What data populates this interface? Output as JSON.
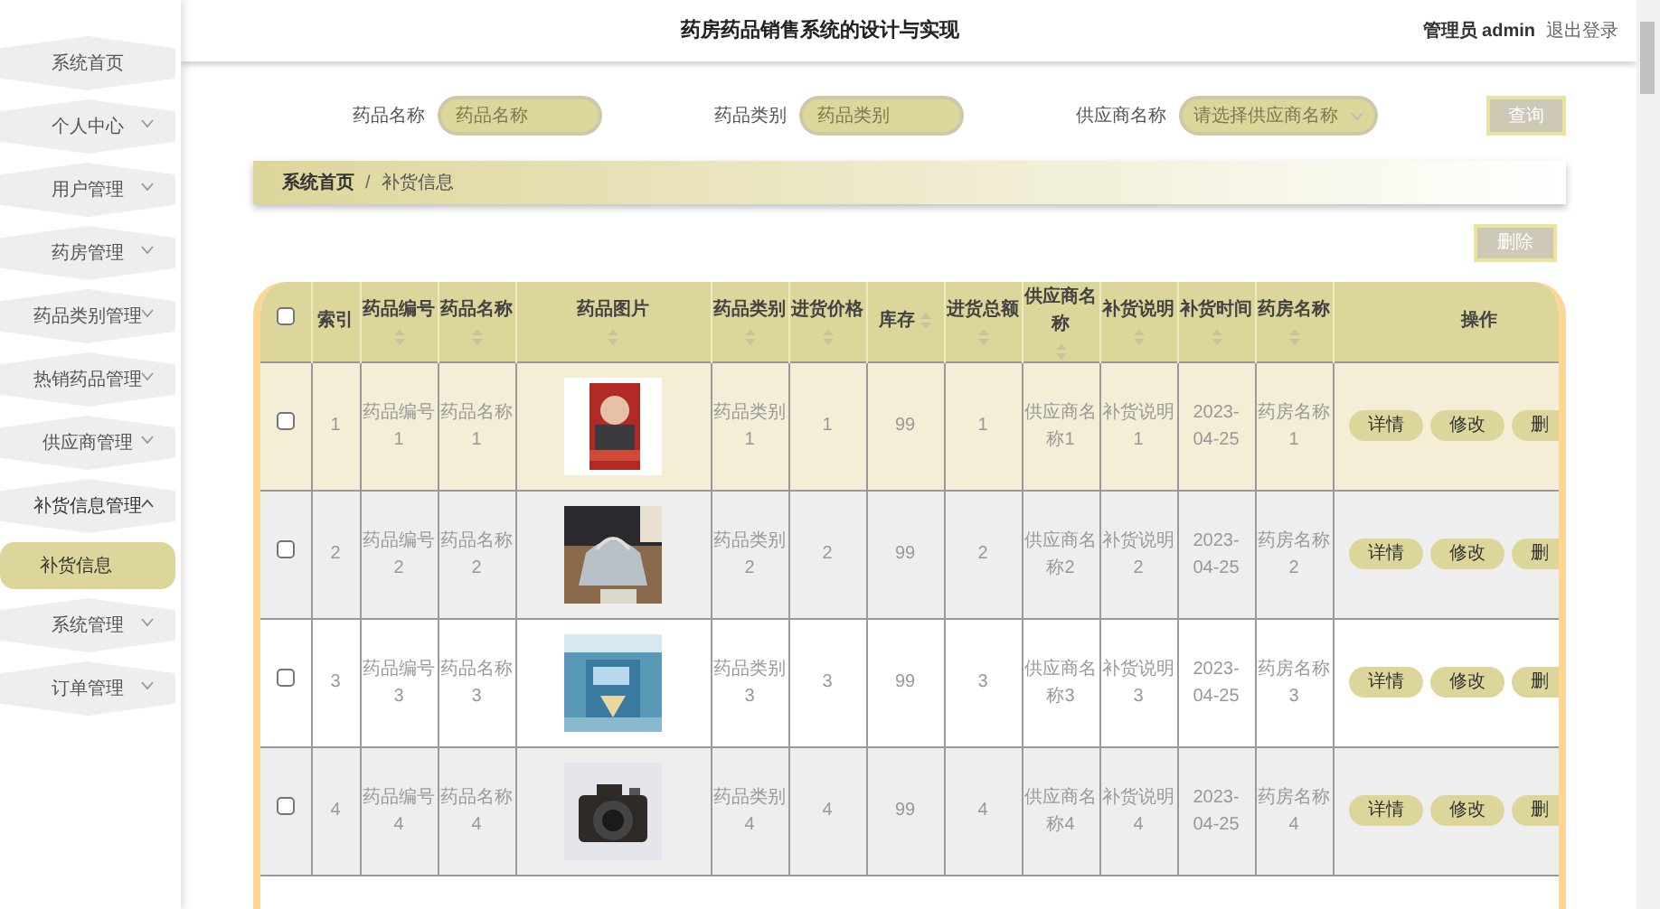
{
  "header": {
    "title": "药房药品销售系统的设计与实现",
    "user_role": "管理员",
    "user_name": "admin",
    "logout": "退出登录"
  },
  "sidebar": {
    "items": [
      {
        "label": "系统首页",
        "kind": "link"
      },
      {
        "label": "个人中心",
        "kind": "menu",
        "expanded": false
      },
      {
        "label": "用户管理",
        "kind": "menu",
        "expanded": false
      },
      {
        "label": "药房管理",
        "kind": "menu",
        "expanded": false
      },
      {
        "label": "药品类别管理",
        "kind": "menu",
        "expanded": false
      },
      {
        "label": "热销药品管理",
        "kind": "menu",
        "expanded": false
      },
      {
        "label": "供应商管理",
        "kind": "menu",
        "expanded": false
      },
      {
        "label": "补货信息管理",
        "kind": "menu",
        "expanded": true,
        "children": [
          {
            "label": "补货信息",
            "selected": true
          }
        ]
      },
      {
        "label": "系统管理",
        "kind": "menu",
        "expanded": false
      },
      {
        "label": "订单管理",
        "kind": "menu",
        "expanded": false
      }
    ]
  },
  "search": {
    "fields": [
      {
        "label": "药品名称",
        "placeholder": "药品名称",
        "kind": "input"
      },
      {
        "label": "药品类别",
        "placeholder": "药品类别",
        "kind": "input"
      },
      {
        "label": "供应商名称",
        "placeholder": "请选择供应商名称",
        "kind": "select"
      }
    ],
    "button": "查询"
  },
  "breadcrumb": {
    "items": [
      "系统首页",
      "补货信息"
    ],
    "separator": "/"
  },
  "delete_button": "删除",
  "table": {
    "select_all_checked": false,
    "columns": [
      {
        "label": "索引",
        "kind": "text",
        "sortable": false
      },
      {
        "label": "药品编号",
        "kind": "text",
        "sortable": true
      },
      {
        "label": "药品名称",
        "kind": "text",
        "sortable": true
      },
      {
        "label": "药品图片",
        "kind": "picture",
        "sortable": true
      },
      {
        "label": "药品类别",
        "kind": "text",
        "sortable": true
      },
      {
        "label": "进货价格",
        "kind": "text",
        "sortable": true
      },
      {
        "label": "库存",
        "kind": "text",
        "sortable": true
      },
      {
        "label": "进货总额",
        "kind": "text",
        "sortable": true
      },
      {
        "label": "供应商名称",
        "kind": "text",
        "sortable": true
      },
      {
        "label": "补货说明",
        "kind": "text",
        "sortable": true
      },
      {
        "label": "补货时间",
        "kind": "text",
        "sortable": true
      },
      {
        "label": "药房名称",
        "kind": "text",
        "sortable": true
      },
      {
        "label": "操作",
        "kind": "actions",
        "sortable": false
      }
    ],
    "rows": [
      {
        "checked": false,
        "hovered": true,
        "cells": [
          "1",
          "药品编号1",
          "药品名称1",
          null,
          "药品类别1",
          "1",
          "99",
          "1",
          "供应商名称1",
          "补货说明1",
          "2023-04-25",
          "药房名称1",
          null
        ],
        "actions": [
          "详情",
          "修改",
          "删"
        ]
      },
      {
        "checked": false,
        "hovered": false,
        "cells": [
          "2",
          "药品编号2",
          "药品名称2",
          null,
          "药品类别2",
          "2",
          "99",
          "2",
          "供应商名称2",
          "补货说明2",
          "2023-04-25",
          "药房名称2",
          null
        ],
        "actions": [
          "详情",
          "修改",
          "删"
        ]
      },
      {
        "checked": false,
        "hovered": false,
        "cells": [
          "3",
          "药品编号3",
          "药品名称3",
          null,
          "药品类别3",
          "3",
          "99",
          "3",
          "供应商名称3",
          "补货说明3",
          "2023-04-25",
          "药房名称3",
          null
        ],
        "actions": [
          "详情",
          "修改",
          "删"
        ]
      },
      {
        "checked": false,
        "hovered": false,
        "cells": [
          "4",
          "药品编号4",
          "药品名称4",
          null,
          "药品类别4",
          "4",
          "99",
          "4",
          "供应商名称4",
          "补货说明4",
          "2023-04-25",
          "药房名称4",
          null
        ],
        "actions": [
          "详情",
          "修改",
          "删"
        ]
      }
    ]
  }
}
